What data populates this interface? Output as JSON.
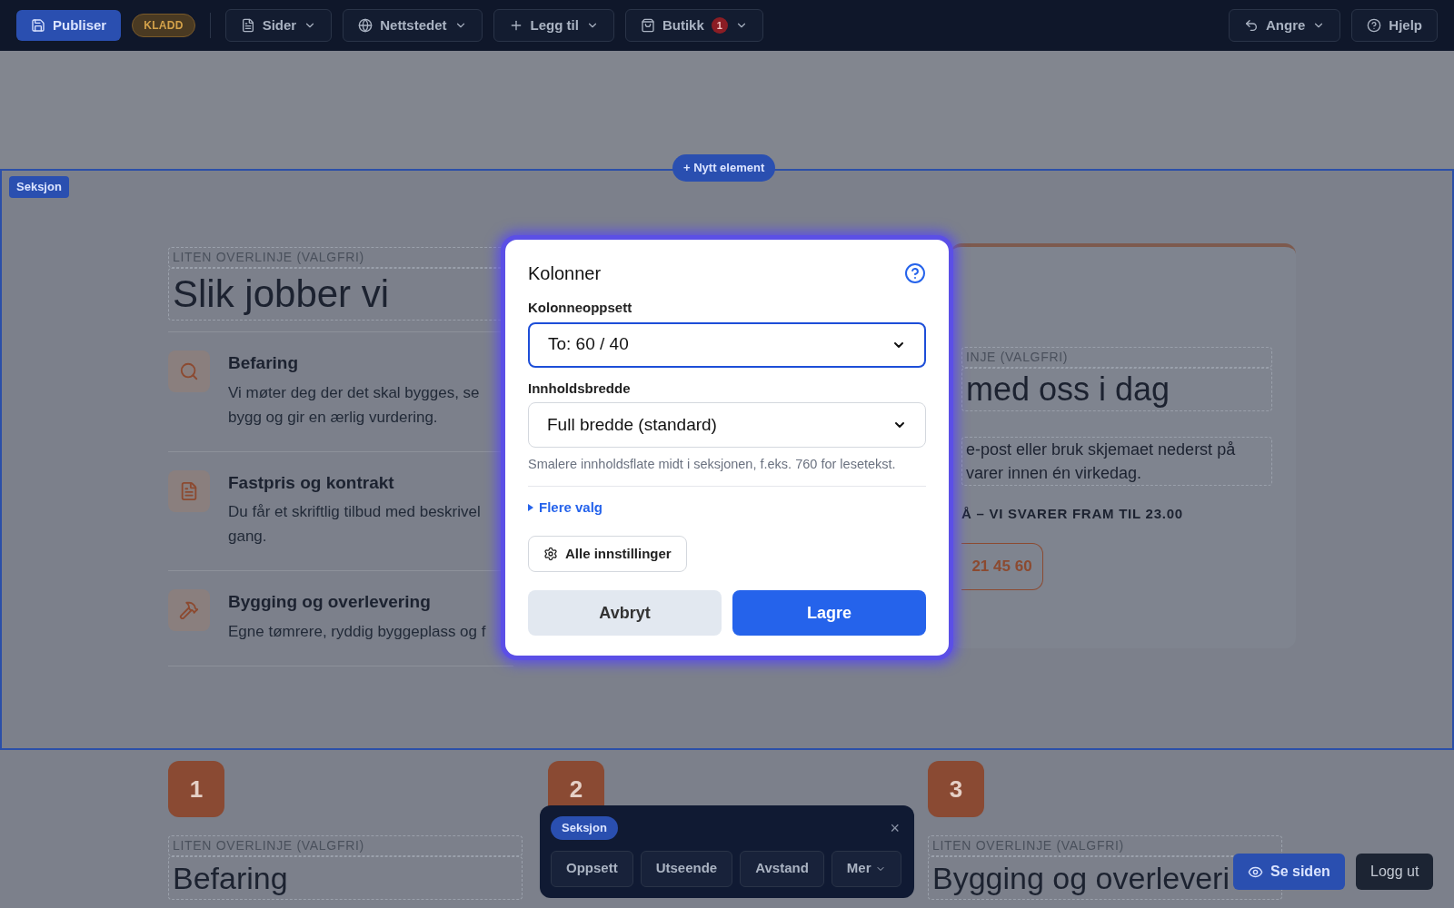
{
  "toolbar": {
    "publish": "Publiser",
    "status_badge": "KLADD",
    "menus": [
      {
        "label": "Sider"
      },
      {
        "label": "Nettstedet"
      },
      {
        "label": "Legg til"
      },
      {
        "label": "Butikk",
        "badge": "1"
      }
    ],
    "right": [
      {
        "label": "Angre",
        "dropdown": true
      },
      {
        "label": "Hjelp",
        "dropdown": false
      }
    ]
  },
  "add_element": "+ Nytt element",
  "section_badge": "Seksjon",
  "left_column": {
    "overline": "LITEN OVERLINJE (VALGFRI)",
    "heading": "Slik jobber vi",
    "steps": [
      {
        "title": "Befaring",
        "lines": [
          "Vi møter deg der det skal bygges, se",
          "bygg og gir en ærlig vurdering."
        ]
      },
      {
        "title": "Fastpris og kontrakt",
        "lines": [
          "Du får et skriftlig tilbud med beskrivel",
          "gang."
        ]
      },
      {
        "title": "Bygging og overlevering",
        "lines": [
          "Egne tømrere, ryddig byggeplass og f"
        ]
      }
    ]
  },
  "right_card": {
    "overline": "INJE (VALGFRI)",
    "heading": "med oss i dag",
    "lines": [
      "e-post eller bruk skjemaet nederst på",
      "varer innen én virkedag."
    ],
    "hours": "Å – VI SVARER FRAM TIL 23.00",
    "phone": "21 45 60"
  },
  "modal": {
    "title": "Kolonner",
    "fields": [
      {
        "label": "Kolonneoppsett",
        "value": "To: 60 / 40",
        "focused": true
      },
      {
        "label": "Innholdsbredde",
        "value": "Full bredde (standard)",
        "focused": false,
        "hint": "Smalere innholdsflate midt i seksjonen, f.eks. 760 for lesetekst."
      }
    ],
    "more": "Flere valg",
    "all_settings": "Alle innstillinger",
    "cancel": "Avbryt",
    "save": "Lagre"
  },
  "steps_row": [
    {
      "number": "1",
      "overline": "LITEN OVERLINJE (VALGFRI)",
      "heading": "Befaring"
    },
    {
      "number": "2"
    },
    {
      "number": "3",
      "overline": "LITEN OVERLINJE (VALGFRI)",
      "heading": "Bygging og overleveri"
    }
  ],
  "section_toolbar": {
    "badge": "Seksjon",
    "close": "×",
    "buttons": [
      {
        "label": "Oppsett",
        "dropdown": false
      },
      {
        "label": "Utseende",
        "dropdown": false
      },
      {
        "label": "Avstand",
        "dropdown": false
      },
      {
        "label": "Mer",
        "dropdown": true
      }
    ]
  },
  "view_site": "Se siden",
  "logout": "Logg ut"
}
